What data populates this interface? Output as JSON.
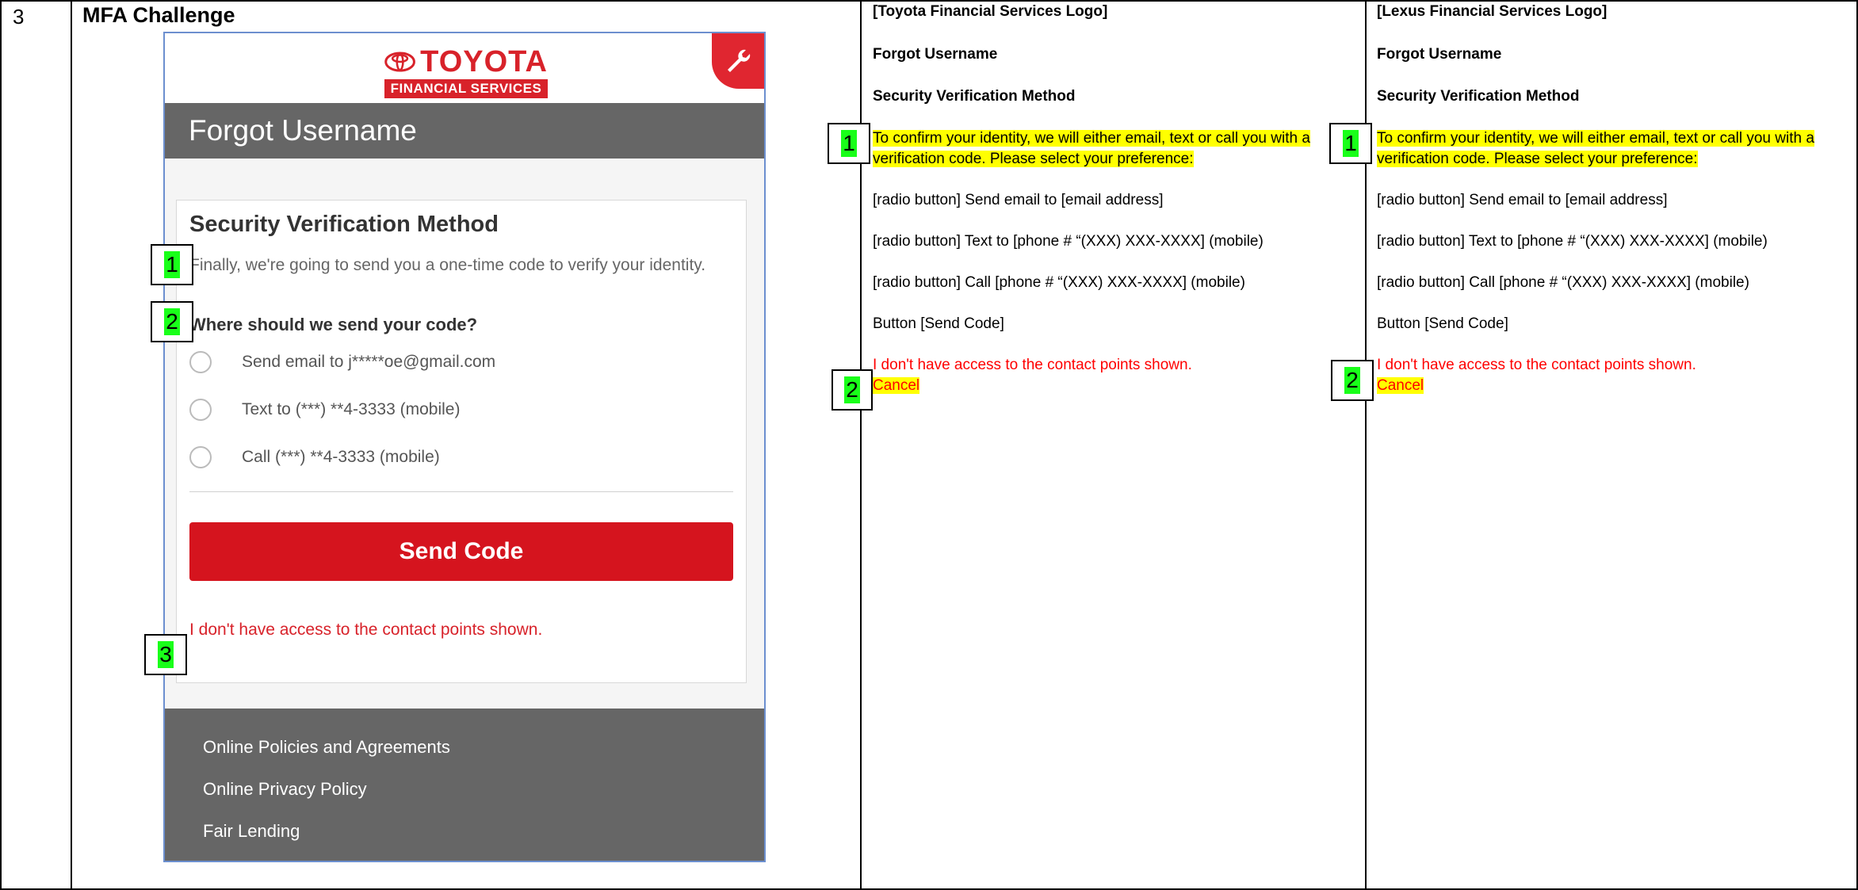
{
  "row_number": "3",
  "section_title": "MFA Challenge",
  "mockup": {
    "logo": {
      "brand": "TOYOTA",
      "sub": "FINANCIAL SERVICES",
      "emblem": "toyota-emblem-icon"
    },
    "tool_icon": "wrench-icon",
    "page_title": "Forgot Username",
    "card_title": "Security Verification Method",
    "description": "Finally, we're going to send you a one-time code to verify your identity.",
    "question": "Where should we send your code?",
    "options": [
      "Send email to j*****oe@gmail.com",
      "Text to (***) **4-3333 (mobile)",
      "Call (***) **4-3333 (mobile)"
    ],
    "send_button": "Send Code",
    "no_access_link": "I don't have access to the contact points shown.",
    "footer_links": [
      "Online Policies and Agreements",
      "Online Privacy Policy",
      "Fair Lending"
    ]
  },
  "markers": {
    "m1": "1",
    "m2": "2",
    "m3": "3"
  },
  "spec_toyota": {
    "logo": "[Toyota Financial Services Logo]",
    "title": "Forgot Username",
    "heading": "Security Verification Method",
    "intro_line1": "To confirm your identity, we will either email, text or call you with a",
    "intro_line2": "verification code. Please select your preference:",
    "radio_email": "[radio button] Send email to [email address]",
    "radio_text": "[radio button] Text to [phone # “(XXX) XXX-XXXX] (mobile)",
    "radio_call": "[radio button] Call [phone # “(XXX) XXX-XXXX] (mobile)",
    "button": "Button [Send Code]",
    "no_access": "I don't have access to the contact points shown.",
    "cancel": "Cancel"
  },
  "spec_lexus": {
    "logo": "[Lexus Financial Services Logo]",
    "title": "Forgot Username",
    "heading": "Security Verification Method",
    "intro_line1": "To confirm your identity, we will either email, text or call you with a",
    "intro_line2": "verification code. Please select your preference:",
    "radio_email": "[radio button] Send email to [email address]",
    "radio_text": "[radio button] Text to [phone # “(XXX) XXX-XXXX] (mobile)",
    "radio_call": "[radio button] Call [phone # “(XXX) XXX-XXXX] (mobile)",
    "button": "Button [Send Code]",
    "no_access": "I don't have access to the contact points shown.",
    "cancel": "Cancel"
  },
  "colors": {
    "brand_red": "#d8222a",
    "button_red": "#d5141e",
    "titlebar_gray": "#666666",
    "marker_green": "#19ff19",
    "highlight_yellow": "#ffff00",
    "spec_red": "#ff0000"
  }
}
